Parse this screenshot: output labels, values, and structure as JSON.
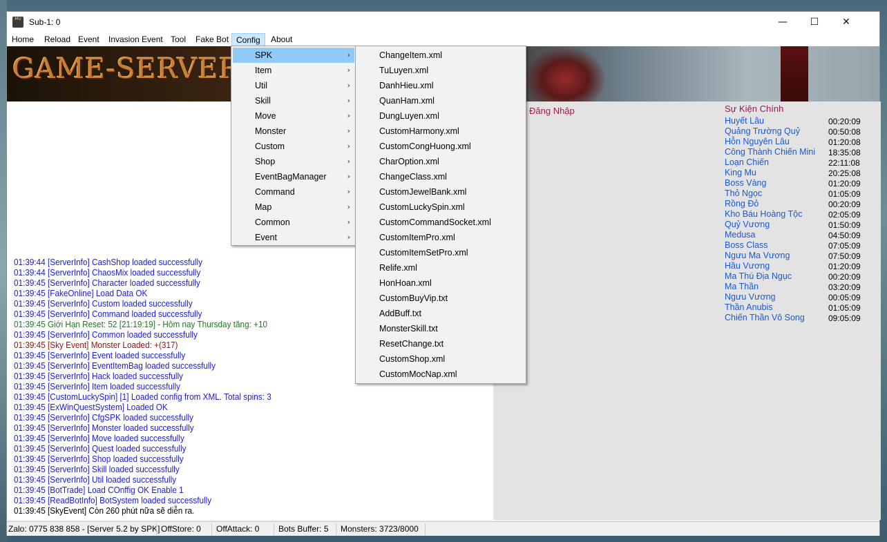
{
  "window": {
    "title": "Sub-1: 0",
    "icon_text": "MU",
    "minimize": "—",
    "maximize": "☐",
    "close": "✕"
  },
  "menubar": [
    "Home",
    "Reload",
    "Event",
    "Invasion Event",
    "Tool",
    "Fake Bot",
    "Config",
    "About"
  ],
  "banner": {
    "logo_text": "GAME-SERVER 5"
  },
  "config_menu": [
    {
      "label": "SPK",
      "arrow": "›"
    },
    {
      "label": "Item",
      "arrow": "›"
    },
    {
      "label": "Util",
      "arrow": "›"
    },
    {
      "label": "Skill",
      "arrow": "›"
    },
    {
      "label": "Move",
      "arrow": "›"
    },
    {
      "label": "Monster",
      "arrow": "›"
    },
    {
      "label": "Custom",
      "arrow": "›"
    },
    {
      "label": "Shop",
      "arrow": "›"
    },
    {
      "label": "EventBagManager",
      "arrow": "›"
    },
    {
      "label": "Command",
      "arrow": "›"
    },
    {
      "label": "Map",
      "arrow": "›"
    },
    {
      "label": "Common",
      "arrow": "›"
    },
    {
      "label": "Event",
      "arrow": "›"
    }
  ],
  "spk_submenu": [
    "ChangeItem.xml",
    "TuLuyen.xml",
    "DanhHieu.xml",
    "QuanHam.xml",
    "DungLuyen.xml",
    "CustomHarmony.xml",
    "CustomCongHuong.xml",
    "CharOption.xml",
    "ChangeClass.xml",
    "CustomJewelBank.xml",
    "CustomLuckySpin.xml",
    "CustomCommandSocket.xml",
    "CustomItemPro.xml",
    "CustomItemSetPro.xml",
    "Relife.xml",
    "HonHoan.xml",
    "CustomBuyVip.txt",
    "AddBuff.txt",
    "MonsterSkill.txt",
    "ResetChange.txt",
    "CustomShop.xml",
    "CustomMocNap.xml"
  ],
  "log": [
    {
      "text": "01:39:44 [ServerInfo] CashShop loaded successfully",
      "color": "#1a1ad6"
    },
    {
      "text": "01:39:44 [ServerInfo] ChaosMix loaded successfully",
      "color": "#1a1ad6"
    },
    {
      "text": "01:39:45 [ServerInfo] Character loaded successfully",
      "color": "#1a1ad6"
    },
    {
      "text": "01:39:45 [FakeOnline] Load Data OK",
      "color": "#1a1ad6"
    },
    {
      "text": "01:39:45 [ServerInfo] Custom loaded successfully",
      "color": "#1a1ad6"
    },
    {
      "text": "01:39:45 [ServerInfo] Command loaded successfully",
      "color": "#1a1ad6"
    },
    {
      "text": "01:39:45 Giới Hạn Reset: 52 [21:19:19] - Hôm nay Thursday tăng: +10",
      "color": "#1d7a1d"
    },
    {
      "text": "01:39:45 [ServerInfo] Common loaded successfully",
      "color": "#1a1ad6"
    },
    {
      "text": "01:39:45 [Sky Event] Monster Loaded: +(317)",
      "color": "#a01010"
    },
    {
      "text": "01:39:45 [ServerInfo] Event loaded successfully",
      "color": "#1a1ad6"
    },
    {
      "text": "01:39:45 [ServerInfo] EventItemBag loaded successfully",
      "color": "#1a1ad6"
    },
    {
      "text": "01:39:45 [ServerInfo] Hack loaded successfully",
      "color": "#1a1ad6"
    },
    {
      "text": "01:39:45 [ServerInfo] Item loaded successfully",
      "color": "#1a1ad6"
    },
    {
      "text": "01:39:45 [CustomLuckySpin] [1] Loaded config from XML. Total spins: 3",
      "color": "#1a1ad6"
    },
    {
      "text": "01:39:45 [ExWinQuestSystem] Loaded OK",
      "color": "#1a1ad6"
    },
    {
      "text": "01:39:45 [ServerInfo] CfgSPK loaded successfully",
      "color": "#1a1ad6"
    },
    {
      "text": "01:39:45 [ServerInfo] Monster loaded successfully",
      "color": "#1a1ad6"
    },
    {
      "text": "01:39:45 [ServerInfo] Move loaded successfully",
      "color": "#1a1ad6"
    },
    {
      "text": "01:39:45 [ServerInfo] Quest loaded successfully",
      "color": "#1a1ad6"
    },
    {
      "text": "01:39:45 [ServerInfo] Shop loaded successfully",
      "color": "#1a1ad6"
    },
    {
      "text": "01:39:45 [ServerInfo] Skill loaded successfully",
      "color": "#1a1ad6"
    },
    {
      "text": "01:39:45 [ServerInfo] Util loaded successfully",
      "color": "#1a1ad6"
    },
    {
      "text": "01:39:45 [BotTrade] Load COnffig OK Enable 1",
      "color": "#1a1ad6"
    },
    {
      "text": "01:39:45 [ReadBotInfo] BotSystem loaded successfully",
      "color": "#1a1ad6"
    },
    {
      "text": "01:39:45 [SkyEvent] Còn 260 phút nữa sẽ diễn ra.",
      "color": "#000000"
    }
  ],
  "right_panel": {
    "login_title": "Đăng Nhập",
    "events_title": "Sự Kiện Chính",
    "events": [
      {
        "name": "Huyết Lâu",
        "time": "00:20:09"
      },
      {
        "name": "Quảng Trường Quỷ",
        "time": "00:50:08"
      },
      {
        "name": "Hỗn Nguyên Lâu",
        "time": "01:20:08"
      },
      {
        "name": "Công Thành Chiến Mini",
        "time": "18:35:08"
      },
      {
        "name": "Loạn Chiến",
        "time": "22:11:08"
      },
      {
        "name": "King Mu",
        "time": "20:25:08"
      },
      {
        "name": "Boss Vàng",
        "time": "01:20:09"
      },
      {
        "name": "Thỏ Ngọc",
        "time": "01:05:09"
      },
      {
        "name": "Rồng Đỏ",
        "time": "00:20:09"
      },
      {
        "name": "Kho Báu Hoàng Tộc",
        "time": "02:05:09"
      },
      {
        "name": "Quỷ Vương",
        "time": "01:50:09"
      },
      {
        "name": "Medusa",
        "time": "04:50:09"
      },
      {
        "name": "Boss Class",
        "time": "07:05:09"
      },
      {
        "name": "Ngưu Ma Vương",
        "time": "07:50:09"
      },
      {
        "name": "Hầu Vương",
        "time": "01:20:09"
      },
      {
        "name": "Ma Thú Địa Ngục",
        "time": "00:20:09"
      },
      {
        "name": "Ma Thần",
        "time": "03:20:09"
      },
      {
        "name": "Ngưu Vương",
        "time": "00:05:09"
      },
      {
        "name": "Thần Anubis",
        "time": "01:05:09"
      },
      {
        "name": "Chiến Thần Vô Song",
        "time": "09:05:09"
      }
    ]
  },
  "statusbar": {
    "zalo": "Zalo: 0775 838 858 - [Server 5.2 by SPK]",
    "offstore": "OffStore: 0",
    "offattack": "OffAttack: 0",
    "bots_buffer": "Bots Buffer: 5",
    "monsters": "Monsters: 3723/8000"
  }
}
